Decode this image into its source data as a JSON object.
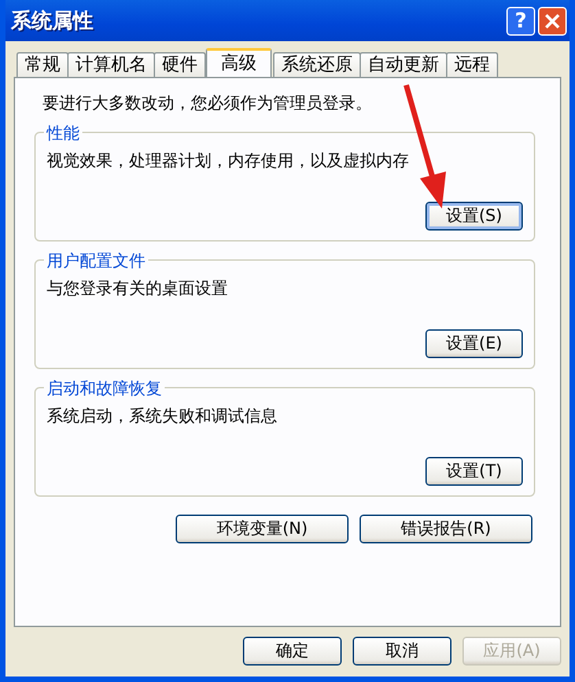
{
  "window": {
    "title": "系统属性",
    "help": "?"
  },
  "tabs": [
    {
      "label": "常规",
      "selected": false
    },
    {
      "label": "计算机名",
      "selected": false
    },
    {
      "label": "硬件",
      "selected": false
    },
    {
      "label": "高级",
      "selected": true
    },
    {
      "label": "系统还原",
      "selected": false
    },
    {
      "label": "自动更新",
      "selected": false
    },
    {
      "label": "远程",
      "selected": false
    }
  ],
  "notice": "要进行大多数改动，您必须作为管理员登录。",
  "groups": [
    {
      "title": "性能",
      "description": "视觉效果，处理器计划，内存使用，以及虚拟内存",
      "button": "设置(S)",
      "focused": true
    },
    {
      "title": "用户配置文件",
      "description": "与您登录有关的桌面设置",
      "button": "设置(E)",
      "focused": false
    },
    {
      "title": "启动和故障恢复",
      "description": "系统启动，系统失败和调试信息",
      "button": "设置(T)",
      "focused": false
    }
  ],
  "extra_buttons": [
    "环境变量(N)",
    "错误报告(R)"
  ],
  "dialog_buttons": [
    {
      "label": "确定",
      "disabled": false
    },
    {
      "label": "取消",
      "disabled": false
    },
    {
      "label": "应用(A)",
      "disabled": true
    }
  ]
}
